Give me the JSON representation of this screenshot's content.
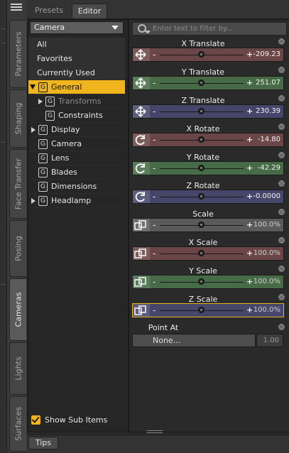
{
  "side_tabs": [
    "Parameters",
    "Shaping",
    "Face Transfer",
    "Posing",
    "Cameras",
    "Lights",
    "Surfaces"
  ],
  "top_tabs": {
    "presets": "Presets",
    "editor": "Editor"
  },
  "camera_select": "Camera",
  "tree": {
    "all": "All",
    "favorites": "Favorites",
    "currently_used": "Currently Used",
    "general": "General",
    "transforms": "Transforms",
    "constraints": "Constraints",
    "display": "Display",
    "camera": "Camera",
    "lens": "Lens",
    "blades": "Blades",
    "dimensions": "Dimensions",
    "headlamp": "Headlamp"
  },
  "show_sub_items": "Show Sub Items",
  "filter_placeholder": "Enter text to filter by...",
  "properties": [
    {
      "name": "X Translate",
      "value": "-209.23",
      "color": "#6b4646",
      "icon": "move-icon"
    },
    {
      "name": "Y Translate",
      "value": "251.07",
      "color": "#466b46",
      "icon": "move-icon"
    },
    {
      "name": "Z Translate",
      "value": "230.39",
      "color": "#46466b",
      "icon": "move-icon"
    },
    {
      "name": "X Rotate",
      "value": "-14.80",
      "color": "#6b4646",
      "icon": "rotate-icon"
    },
    {
      "name": "Y Rotate",
      "value": "-42.29",
      "color": "#466b46",
      "icon": "rotate-icon"
    },
    {
      "name": "Z Rotate",
      "value": "-0.0000",
      "color": "#46466b",
      "icon": "rotate-icon"
    },
    {
      "name": "Scale",
      "value": "100.0%",
      "color": "#5a5a5a",
      "icon": "scale-icon"
    },
    {
      "name": "X Scale",
      "value": "100.0%",
      "color": "#6b4646",
      "icon": "scale-icon"
    },
    {
      "name": "Y Scale",
      "value": "100.0%",
      "color": "#466b46",
      "icon": "scale-icon"
    },
    {
      "name": "Z Scale",
      "value": "100.0%",
      "color": "#46466b",
      "icon": "scale-icon"
    }
  ],
  "point_at": {
    "label": "Point At",
    "value": "None...",
    "number": "1.00"
  },
  "tips": "Tips"
}
